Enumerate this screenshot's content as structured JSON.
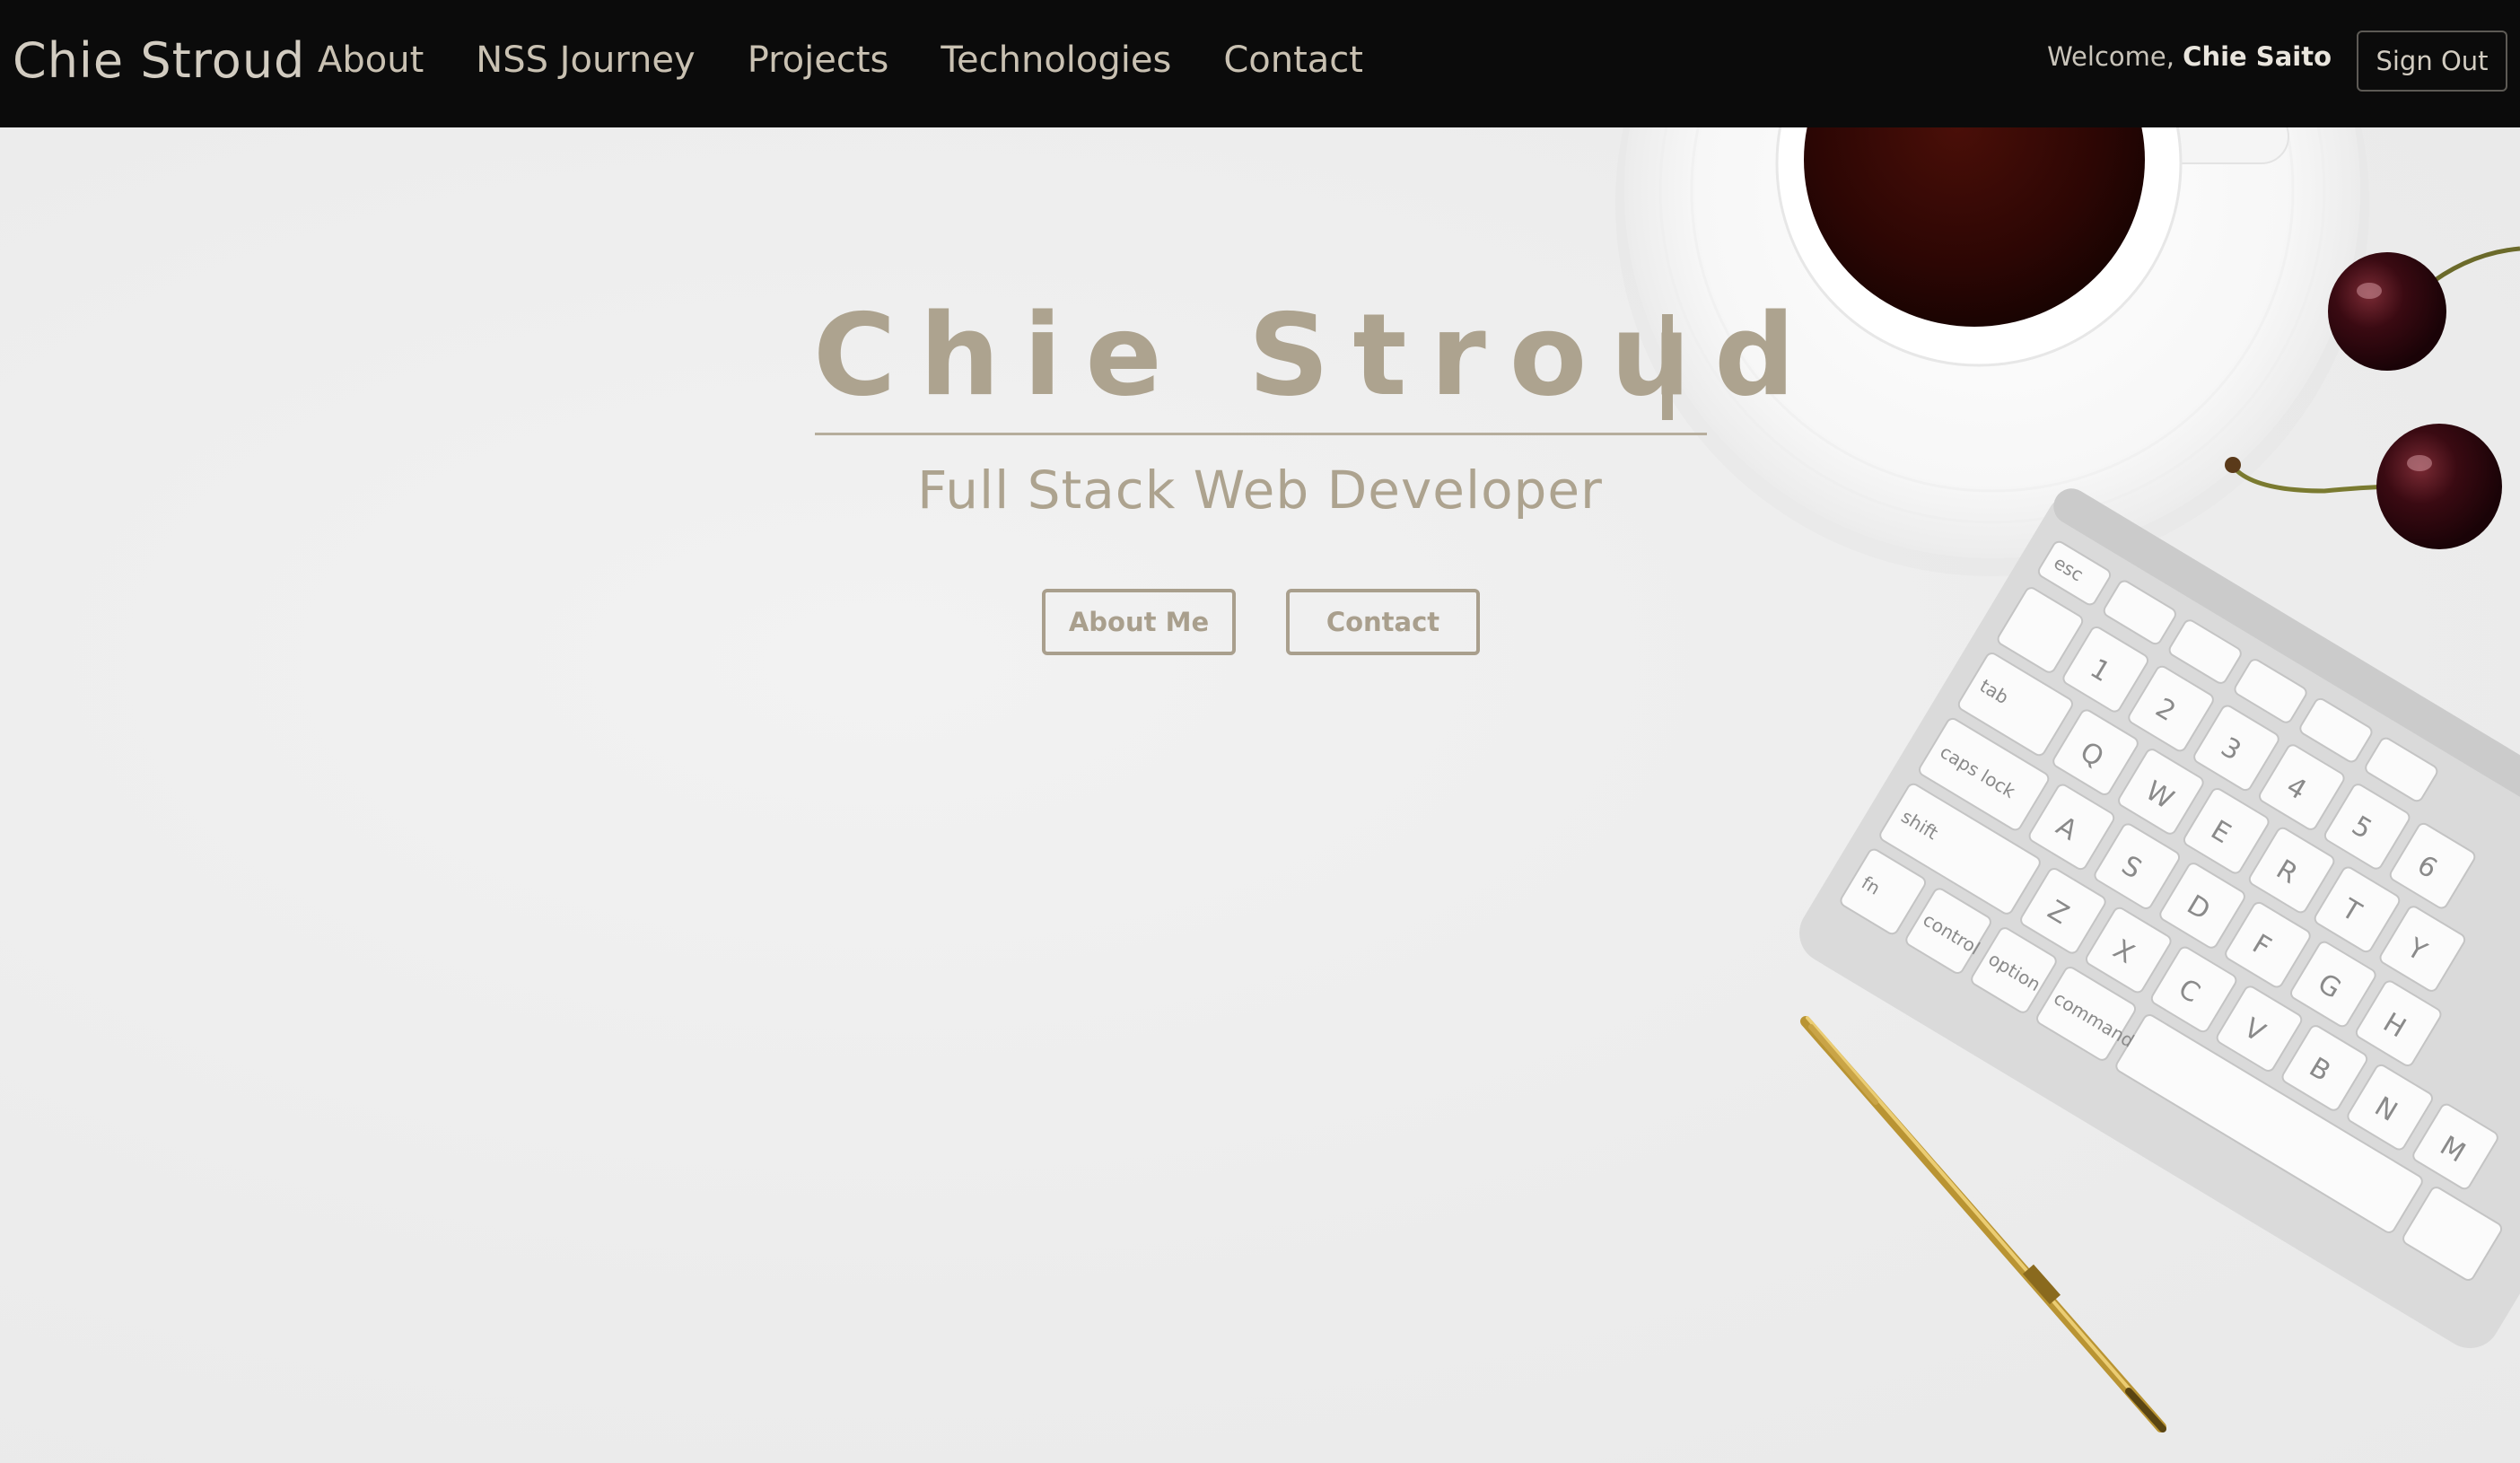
{
  "navbar": {
    "brand": "Chie Stroud",
    "links": [
      "About",
      "NSS Journey",
      "Projects",
      "Technologies",
      "Contact"
    ],
    "welcome_prefix": "Welcome,",
    "welcome_user": "Chie Saito",
    "sign_out_label": "Sign Out"
  },
  "hero": {
    "title": "Chie Stroud",
    "subtitle": "Full Stack Web Developer",
    "about_button": "About Me",
    "contact_button": "Contact",
    "background_image": "desk-flatlay-image"
  },
  "keyboard_keys": {
    "esc": "esc",
    "tab": "tab",
    "caps": "caps lock",
    "shift": "shift",
    "fn": "fn",
    "control": "control",
    "option": "option",
    "command": "command",
    "letters_row1": [
      "Q",
      "W",
      "E",
      "R",
      "T",
      "Y"
    ],
    "letters_row2": [
      "A",
      "S",
      "D",
      "F",
      "G",
      "H"
    ],
    "letters_row3": [
      "Z",
      "X",
      "C",
      "V",
      "B",
      "N",
      "M"
    ],
    "numbers": [
      "1",
      "2",
      "3",
      "4",
      "5",
      "6"
    ]
  },
  "colors": {
    "navbar_bg": "#0b0b0b",
    "accent": "#ada38f",
    "page_bg": "#efefef"
  }
}
